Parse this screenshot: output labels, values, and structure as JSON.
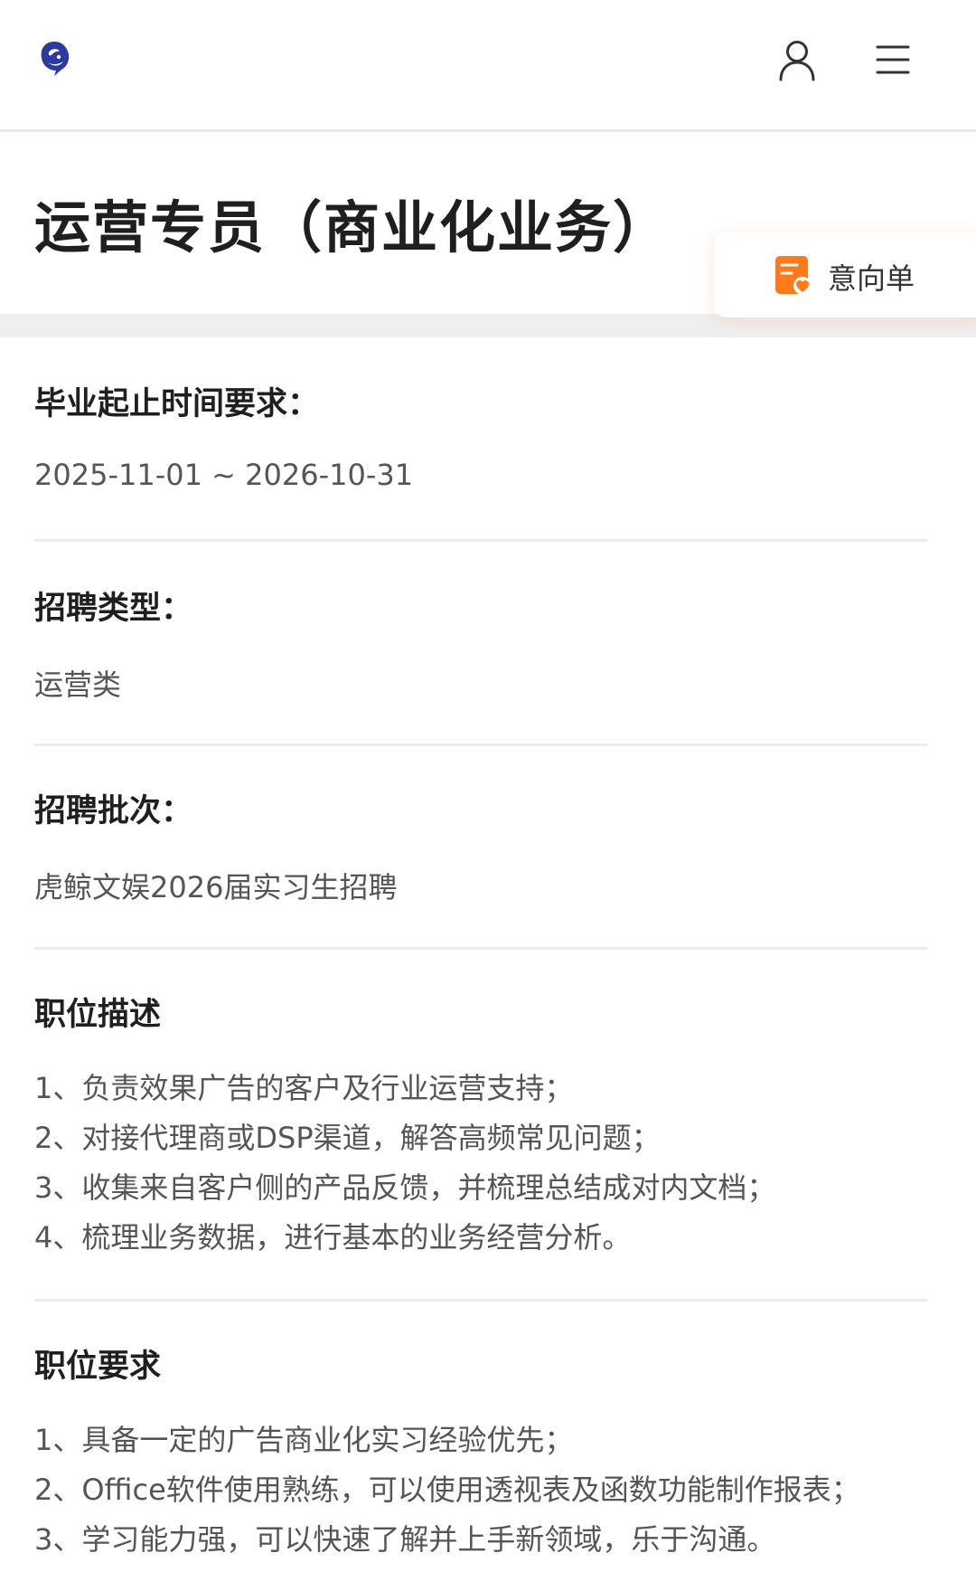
{
  "header": {
    "logo_icon": "whale-logo-icon",
    "user_icon": "user-icon",
    "menu_icon": "menu-icon"
  },
  "job": {
    "title": "运营专员（商业化业务）"
  },
  "intent_button": {
    "label": "意向单",
    "icon": "intent-list-icon",
    "accent": "#ff7a1a"
  },
  "sections": {
    "graduation": {
      "title": "毕业起止时间要求：",
      "value": "2025-11-01 ~ 2026-10-31"
    },
    "recruit_type": {
      "title": "招聘类型：",
      "value": "运营类"
    },
    "batch": {
      "title": "招聘批次：",
      "value": "虎鲸文娱2026届实习生招聘"
    },
    "description": {
      "title": "职位描述",
      "items": [
        "1、负责效果广告的客户及行业运营支持；",
        "2、对接代理商或DSP渠道，解答高频常见问题；",
        "3、收集来自客户侧的产品反馈，并梳理总结成对内文档；",
        "4、梳理业务数据，进行基本的业务经营分析。"
      ]
    },
    "requirements": {
      "title": "职位要求",
      "items": [
        "1、具备一定的广告商业化实习经验优先；",
        "2、Office软件使用熟练，可以使用透视表及函数功能制作报表；",
        "3、学习能力强，可以快速了解并上手新领域，乐于沟通。"
      ]
    }
  }
}
